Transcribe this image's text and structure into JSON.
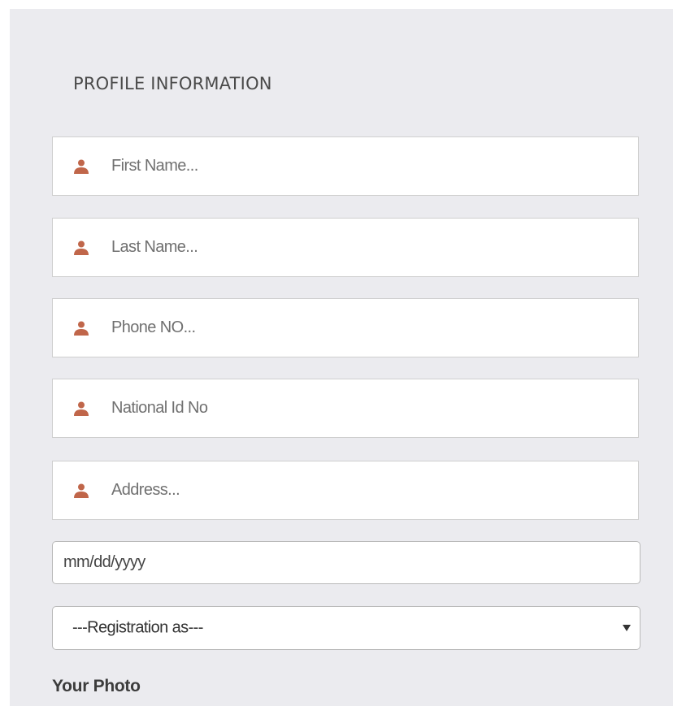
{
  "form": {
    "section_title": "PROFILE INFORMATION",
    "fields": [
      {
        "name": "first-name-input",
        "placeholder": "First Name...",
        "icon": "user-icon"
      },
      {
        "name": "last-name-input",
        "placeholder": "Last Name...",
        "icon": "user-icon"
      },
      {
        "name": "phone-input",
        "placeholder": "Phone NO...",
        "icon": "user-icon"
      },
      {
        "name": "national-id-input",
        "placeholder": "National Id No",
        "icon": "user-icon"
      },
      {
        "name": "address-input",
        "placeholder": "Address...",
        "icon": "user-icon"
      }
    ],
    "date": {
      "placeholder": "mm/dd/yyyy"
    },
    "registration": {
      "selected": "---Registration as---"
    },
    "photo_label": "Your Photo"
  },
  "colors": {
    "panel_bg": "#ebebef",
    "icon": "#c0664a",
    "field_border": "#cfcfcf"
  }
}
